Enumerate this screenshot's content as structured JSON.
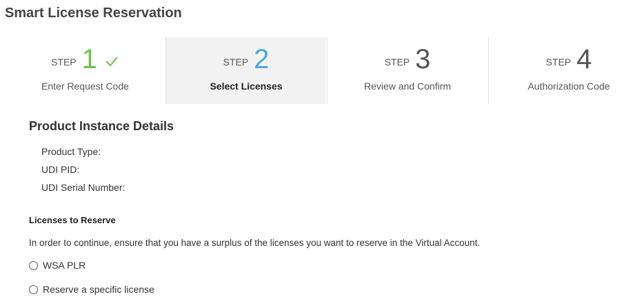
{
  "page": {
    "title": "Smart License Reservation"
  },
  "wizard": {
    "step_word": "STEP",
    "steps": [
      {
        "number": "1",
        "label": "Enter Request Code",
        "state": "completed",
        "icon": "check-icon"
      },
      {
        "number": "2",
        "label": "Select Licenses",
        "state": "current"
      },
      {
        "number": "3",
        "label": "Review and Confirm",
        "state": "upcoming"
      },
      {
        "number": "4",
        "label": "Authorization Code",
        "state": "upcoming"
      }
    ]
  },
  "product_details": {
    "heading": "Product Instance Details",
    "fields": {
      "product_type": "Product Type:",
      "udi_pid": "UDI PID:",
      "udi_serial": "UDI Serial Number:"
    }
  },
  "licenses": {
    "heading": "Licenses to Reserve",
    "info": "In order to continue, ensure that you have a surplus of the licenses you want to reserve in the Virtual Account.",
    "options": [
      {
        "label": "WSA PLR",
        "selected": false
      },
      {
        "label": "Reserve a specific license",
        "selected": false
      }
    ]
  },
  "colors": {
    "completed": "#6cc04a",
    "current": "#49a9df",
    "active_bg": "#f2f2f2"
  }
}
